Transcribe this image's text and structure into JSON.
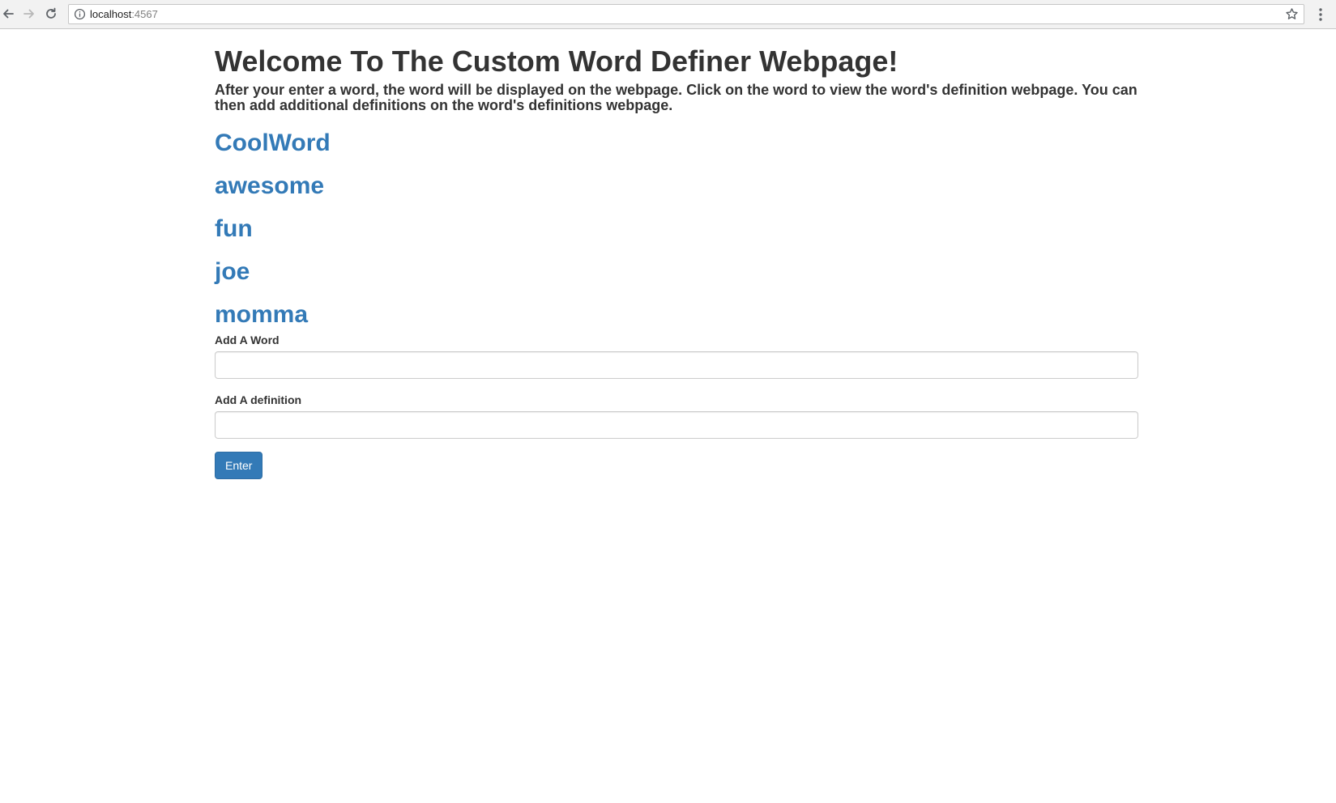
{
  "browser": {
    "url_host": "localhost",
    "url_port": ":4567"
  },
  "page": {
    "title": "Welcome To The Custom Word Definer Webpage!",
    "intro": "After your enter a word, the word will be displayed on the webpage. Click on the word to view the word's definition webpage. You can then add additional definitions on the word's definitions webpage."
  },
  "words": [
    "CoolWord",
    "awesome",
    "fun",
    "joe",
    "momma"
  ],
  "form": {
    "word_label": "Add A Word",
    "word_value": "",
    "definition_label": "Add A definition",
    "definition_value": "",
    "submit_label": "Enter"
  },
  "colors": {
    "link": "#337ab7",
    "button": "#337ab7",
    "text": "#333333"
  }
}
